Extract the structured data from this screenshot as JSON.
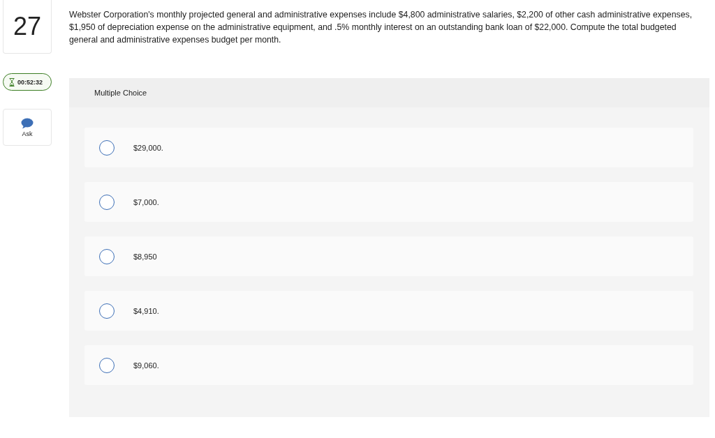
{
  "question": {
    "number": "27",
    "text": "Webster Corporation's monthly projected general and administrative expenses include $4,800 administrative salaries, $2,200 of other cash administrative expenses, $1,950 of depreciation expense on the administrative equipment, and .5% monthly interest on an outstanding bank loan of $22,000. Compute the total budgeted general and administrative expenses budget per month."
  },
  "timer": "00:52:32",
  "ask": {
    "label": "Ask"
  },
  "answer_panel": {
    "title": "Multiple Choice",
    "options": [
      {
        "label": "$29,000.",
        "selected": false
      },
      {
        "label": "$7,000.",
        "selected": false
      },
      {
        "label": "$8,950",
        "selected": false
      },
      {
        "label": "$4,910.",
        "selected": false
      },
      {
        "label": "$9,060.",
        "selected": false
      }
    ]
  }
}
